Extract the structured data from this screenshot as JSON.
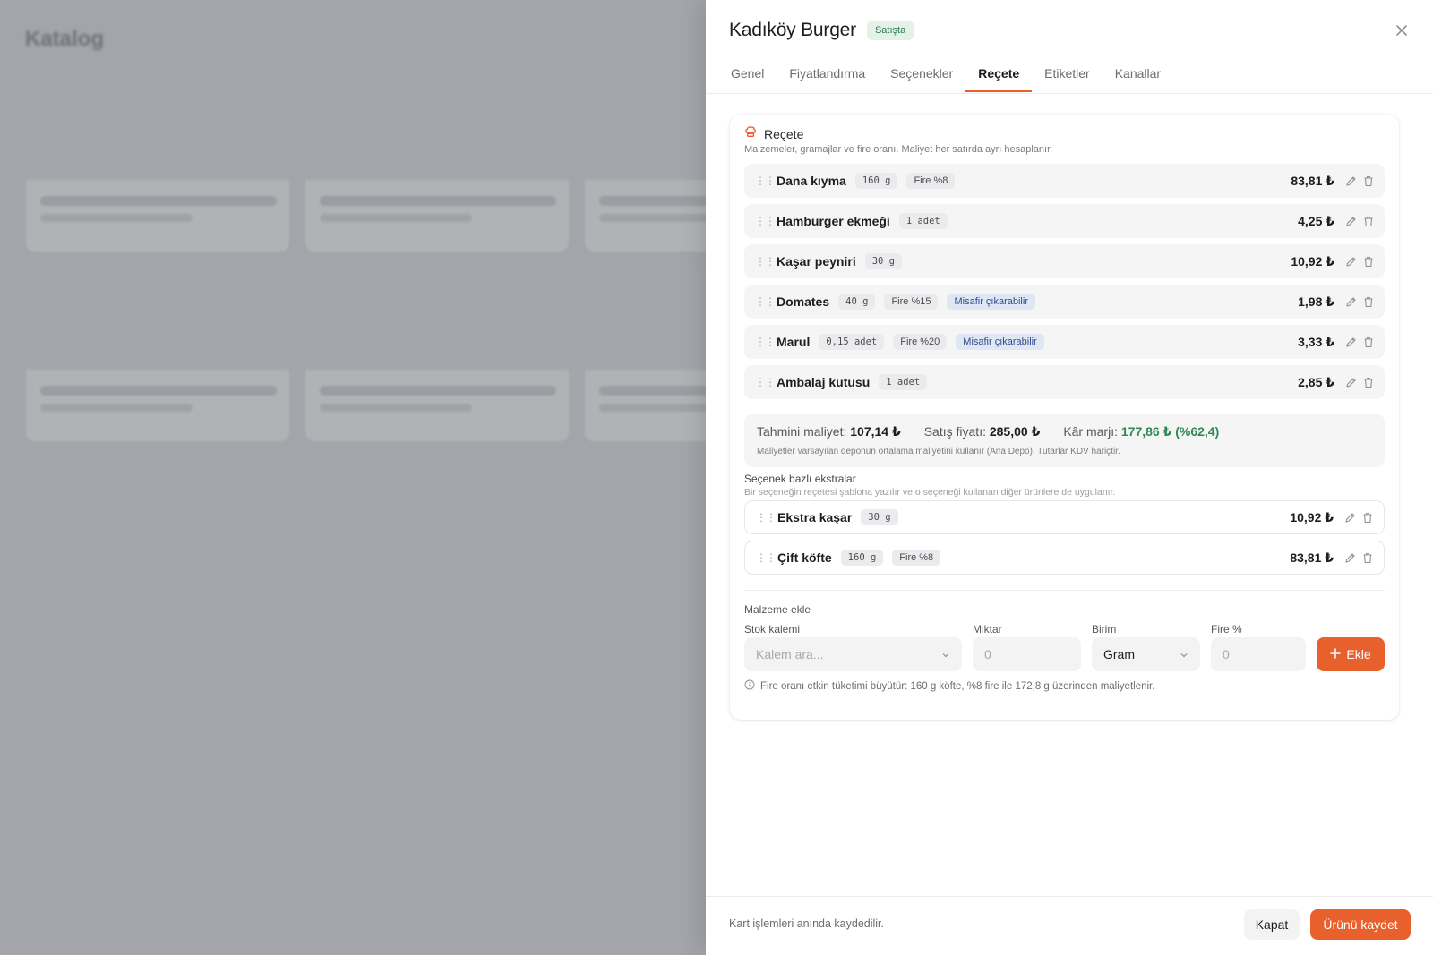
{
  "background": {
    "title": "Katalog"
  },
  "drawer": {
    "product_name": "Kadıköy Burger",
    "status_badge": "Satışta",
    "tabs": [
      {
        "label": "Genel"
      },
      {
        "label": "Fiyatlandırma"
      },
      {
        "label": "Seçenekler"
      },
      {
        "label": "Reçete",
        "active": true
      },
      {
        "label": "Etiketler"
      },
      {
        "label": "Kanallar"
      }
    ],
    "recipe": {
      "title": "Reçete",
      "subtitle": "Malzemeler, gramajlar ve fire oranı. Maliyet her satırda ayrı hesaplanır.",
      "items": [
        {
          "name": "Dana kıyma",
          "qty": "160 g",
          "fire": "Fire %8",
          "removable": "",
          "cost": "83,81 ₺"
        },
        {
          "name": "Hamburger ekmeği",
          "qty": "1 adet",
          "fire": "",
          "removable": "",
          "cost": "4,25 ₺"
        },
        {
          "name": "Kaşar peyniri",
          "qty": "30 g",
          "fire": "",
          "removable": "",
          "cost": "10,92 ₺"
        },
        {
          "name": "Domates",
          "qty": "40 g",
          "fire": "Fire %15",
          "removable": "Misafir çıkarabilir",
          "cost": "1,98 ₺"
        },
        {
          "name": "Marul",
          "qty": "0,15 adet",
          "fire": "Fire %20",
          "removable": "Misafir çıkarabilir",
          "cost": "3,33 ₺"
        },
        {
          "name": "Ambalaj kutusu",
          "qty": "1 adet",
          "fire": "",
          "removable": "",
          "cost": "2,85 ₺"
        }
      ],
      "summary": {
        "cost_label": "Tahmini maliyet:",
        "cost_value": "107,14 ₺",
        "price_label": "Satış fiyatı:",
        "price_value": "285,00 ₺",
        "margin_label": "Kâr marjı:",
        "margin_value": "177,86 ₺ (%62,4)",
        "note": "Maliyetler varsayılan deponun ortalama maliyetini kullanır (Ana Depo). Tutarlar KDV hariçtir."
      },
      "extras_title": "Seçenek bazlı ekstralar",
      "extras_subtitle": "Bir seçeneğin reçetesi şablona yazılır ve o seçeneği kullanan diğer ürünlere de uygulanır.",
      "extras": [
        {
          "name": "Ekstra kaşar",
          "qty": "30 g",
          "fire": "",
          "cost": "10,92 ₺"
        },
        {
          "name": "Çift köfte",
          "qty": "160 g",
          "fire": "Fire %8",
          "cost": "83,81 ₺"
        }
      ],
      "add_form": {
        "title": "Malzeme ekle",
        "stock_label": "Stok kalemi",
        "stock_placeholder": "Kalem ara...",
        "qty_label": "Miktar",
        "qty_placeholder": "0",
        "unit_label": "Birim",
        "unit_value": "Gram",
        "fire_label": "Fire %",
        "fire_placeholder": "0",
        "add_button": "Ekle",
        "hint": "Fire oranı etkin tüketimi büyütür: 160 g köfte, %8 fire ile 172,8 g üzerinden maliyetlenir."
      }
    },
    "footer": {
      "note": "Kart işlemleri anında kaydedilir.",
      "close_button": "Kapat",
      "save_button": "Ürünü kaydet"
    }
  },
  "colors": {
    "accent": "#e8602c",
    "success": "#2e8a56",
    "badge_blue": "#dfe6f4"
  }
}
